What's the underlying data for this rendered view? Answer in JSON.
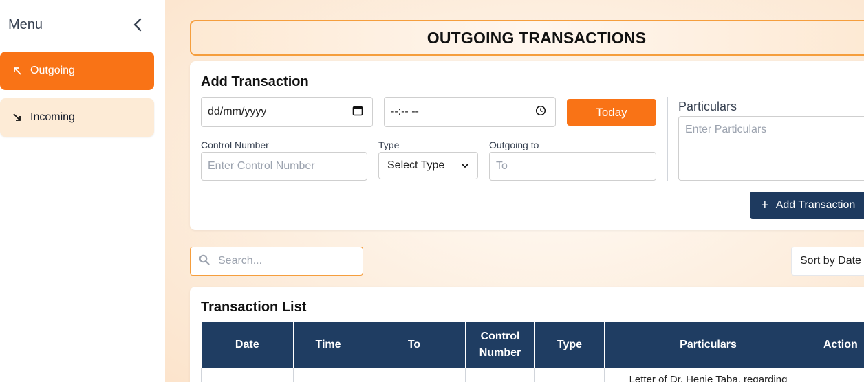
{
  "sidebar": {
    "title": "Menu",
    "items": [
      {
        "label": "Outgoing",
        "icon": "arrow-up-left-icon",
        "active": true
      },
      {
        "label": "Incoming",
        "icon": "arrow-down-right-icon",
        "active": false
      }
    ]
  },
  "header": {
    "title": "OUTGOING TRANSACTIONS"
  },
  "add_form": {
    "title": "Add Transaction",
    "date_placeholder": "dd/mm/yyyy",
    "time_placeholder": "--:-- --",
    "today_label": "Today",
    "control_number_label": "Control Number",
    "control_number_placeholder": "Enter Control Number",
    "type_label": "Type",
    "type_selected": "Select Type",
    "outgoing_to_label": "Outgoing to",
    "outgoing_to_placeholder": "To",
    "particulars_label": "Particulars",
    "particulars_placeholder": "Enter Particulars",
    "add_button_label": "Add Transaction"
  },
  "search": {
    "placeholder": "Search..."
  },
  "sort": {
    "selected": "Sort by Date"
  },
  "list": {
    "title": "Transaction List",
    "columns": [
      "Date",
      "Time",
      "To",
      "Control Number",
      "Type",
      "Particulars",
      "Action"
    ],
    "rows": [
      {
        "date": "",
        "time": "",
        "to": "",
        "control_number": "",
        "type": "",
        "particulars": "Letter of Dr. Henie Taba, regarding",
        "action": ""
      }
    ]
  },
  "colors": {
    "accent": "#f97316",
    "navy": "#1f3d62",
    "border_accent": "#f59e3d"
  }
}
